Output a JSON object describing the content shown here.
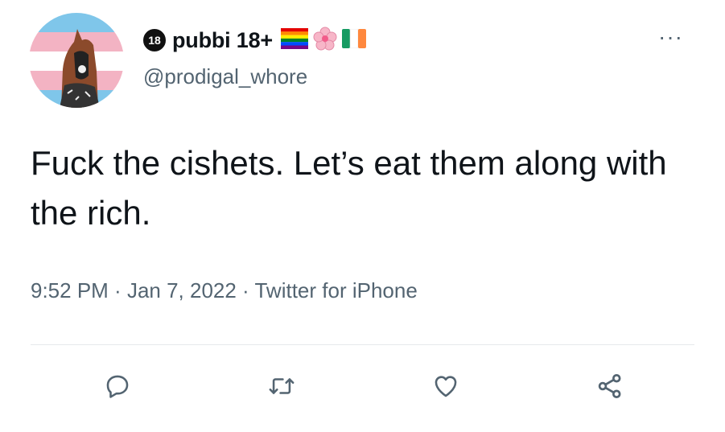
{
  "tweet": {
    "display_name": "pubbi 18+",
    "age_badge": "18",
    "handle": "@prodigal_whore",
    "text": "Fuck the cishets. Let’s eat them along with the rich.",
    "time": "9:52 PM",
    "date": "Jan 7, 2022",
    "source": "Twitter for iPhone",
    "separator": " · ",
    "more_label": "···"
  },
  "icons": {
    "more": "more-dots-icon",
    "flags": [
      "rainbow-flag-icon",
      "cherry-blossom-icon",
      "ireland-flag-icon"
    ],
    "actions": [
      "reply-icon",
      "retweet-icon",
      "like-icon",
      "share-icon"
    ]
  },
  "colors": {
    "text": "#0f1419",
    "secondary": "#536471",
    "divider": "#e6e9eb",
    "trans_blue": "#5bcefa",
    "trans_pink": "#f5a9b8"
  }
}
